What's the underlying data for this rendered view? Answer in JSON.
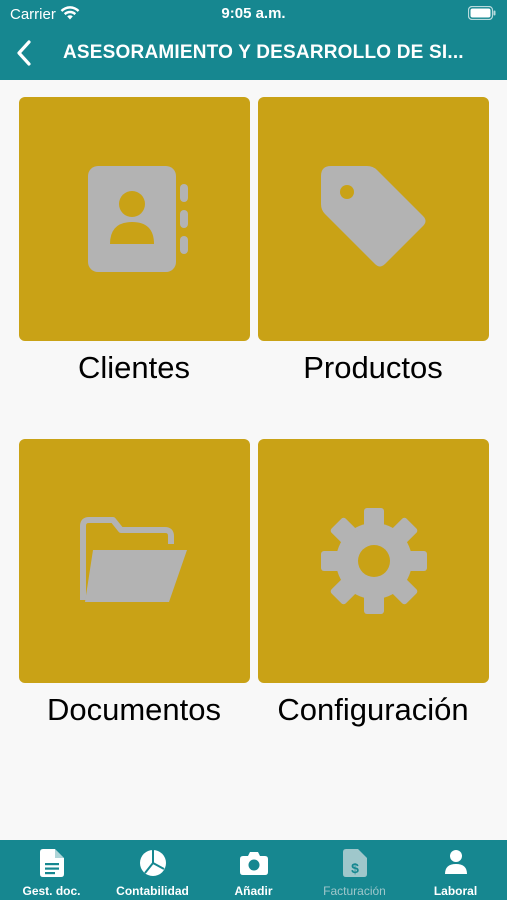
{
  "status_bar": {
    "carrier": "Carrier",
    "time": "9:05 a.m."
  },
  "header": {
    "title": "ASESORAMIENTO Y DESARROLLO DE SI..."
  },
  "grid": {
    "items": [
      {
        "label": "Clientes",
        "icon": "contacts-book-icon"
      },
      {
        "label": "Productos",
        "icon": "price-tag-icon"
      },
      {
        "label": "Documentos",
        "icon": "folder-open-icon"
      },
      {
        "label": "Configuración",
        "icon": "gear-icon"
      }
    ]
  },
  "tab_bar": {
    "items": [
      {
        "label": "Gest. doc.",
        "icon": "document-icon"
      },
      {
        "label": "Contabilidad",
        "icon": "pie-chart-icon"
      },
      {
        "label": "Añadir",
        "icon": "camera-icon"
      },
      {
        "label": "Facturación",
        "icon": "invoice-icon",
        "state": "dimmed"
      },
      {
        "label": "Laboral",
        "icon": "person-icon"
      }
    ]
  },
  "colors": {
    "accent": "#168790",
    "tile": "#c9a216",
    "tile_icon": "#b3b3b3",
    "background": "#f8f8f8"
  }
}
